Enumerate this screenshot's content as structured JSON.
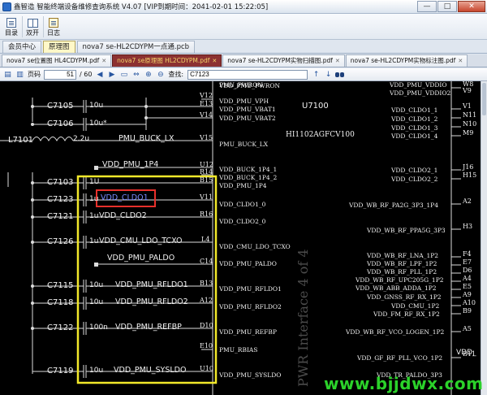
{
  "window": {
    "title": "鑫智造 智能终端设备维修查询系统 V4.07 [VIP到期时间：2041-02-01 15:22:05]",
    "minimize": "—",
    "maximize": "□",
    "close": "✕"
  },
  "toolbar": [
    {
      "label": "目录",
      "icon": "catalog-icon"
    },
    {
      "label": "双开",
      "icon": "dual-open-icon"
    },
    {
      "label": "日志",
      "icon": "log-icon"
    }
  ],
  "top_tabs": [
    "会员中心",
    "原理图",
    "nova7 se-HL2CDYPM一点通.pcb"
  ],
  "active_top_tab": "原理图",
  "doc_tabs": [
    {
      "label": "nova7 se位置图 HL4CDYPM.pdf",
      "active": false
    },
    {
      "label": "nova7 se原理图 HL2CDYPM.pdf",
      "active": true
    },
    {
      "label": "nova7 se-HL2CDYPM实物扫描图.pdf",
      "active": false
    },
    {
      "label": "nova7 se-HL2CDYPM实物标注图.pdf",
      "active": false
    }
  ],
  "pdf_toolbar": {
    "page_label": "页码",
    "current_page": "51",
    "total_pages": "/ 60",
    "find_label": "查找:",
    "find_value": "C7123"
  },
  "schematic": {
    "chip_ref": "U7100",
    "chip_part": "HI1102AGFCV100",
    "interface_text": "PWR Interface 4 of 4",
    "highlight": "VDD_CLDO1",
    "top_cut": "VDD_PMU_PWRON",
    "cap_refs": [
      "C7105",
      "C7106",
      "C7103",
      "C7123",
      "C7121",
      "C7126",
      "C7115",
      "C7118",
      "C7122",
      "C7119"
    ],
    "cap_vals": [
      "10u",
      "10u*",
      "1U",
      "1u",
      "1u",
      "1u",
      "10u",
      "10u",
      "100n",
      "10u"
    ],
    "inductor": {
      "ref": "L7101",
      "val": "2.2u"
    },
    "nets_left": [
      "PMU_BUCK_LX",
      "VDD_PMU_1P4",
      "VDD_CLDO1",
      "VDD_CLDO2",
      "VDD_CMU_LDO_TCXO",
      "VDD_PMU_PALDO",
      "VDD_PMU_RFLDO1",
      "VDD_PMU_RFLDO2",
      "VDD_PMU_REFBP",
      "VDD_PMU_SYSLDO"
    ],
    "pins_left": [
      "V12",
      "E13",
      "V14",
      "V15",
      "U12",
      "R14",
      "B15",
      "V11",
      "R16",
      "L4",
      "C14",
      "B13",
      "A12",
      "D10",
      "E10",
      "U10"
    ],
    "inner_left": [
      "PMU_PWRON",
      "VDD_PMU_VPH",
      "VDD_PMU_VBAT1",
      "VDD_PMU_VBAT2",
      "PMU_BUCK_LX",
      "VDD_BUCK_1P4_1",
      "VDD_BUCK_1P4_2",
      "VDD_PMU_1P4",
      "VDD_CLDO1_0",
      "VDD_CLDO2_0",
      "VDD_CMU_LDO_TCXO",
      "VDD_PMU_PALDO",
      "VDD_PMU_RFLDO1",
      "VDD_PMU_RFLDO2",
      "VDD_PMU_REFBP",
      "PMU_RBIAS",
      "VDD_PMU_SYSLDO"
    ],
    "inner_right": [
      "VDD_PMU_VDDIO",
      "VDD_PMU_VDDIO2",
      "VDD_CLDO1_1",
      "VDD_CLDO1_2",
      "VDD_CLDO1_3",
      "VDD_CLDO1_4",
      "VDD_CLDO2_1",
      "VDD_CLDO2_2",
      "VDD_WB_RF_PA2G_3P3_1P4",
      "VDD_WB_RF_PPA5G_3P3",
      "VDD_WB_RF_LNA_1P2",
      "VDD_WB_RF_LPF_1P2",
      "VDD_WB_RF_PLL_1P2",
      "VDD_WB_RF_UPC205G_1P2",
      "VDD_WB_ABB_ADDA_1P2",
      "VDD_GNSS_RF_RX_1P2",
      "VDD_CMU_1P2",
      "VDD_FM_RF_RX_1P2",
      "VDD_WB_RF_VCO_LOGEN_1P2",
      "VDD_GF_RF_PLL_VCO_1P2",
      "VDD_TR_PALDO_3P3"
    ],
    "pins_right": [
      "W8",
      "V9",
      "V1",
      "N11",
      "N10",
      "M9",
      "J16",
      "H15",
      "A2",
      "H3",
      "F4",
      "E7",
      "D6",
      "A4",
      "E5",
      "A9",
      "A10",
      "B9",
      "A5",
      "B11"
    ],
    "right_edge_net": "VDD_"
  },
  "watermark": "www.bjjdwx.com"
}
